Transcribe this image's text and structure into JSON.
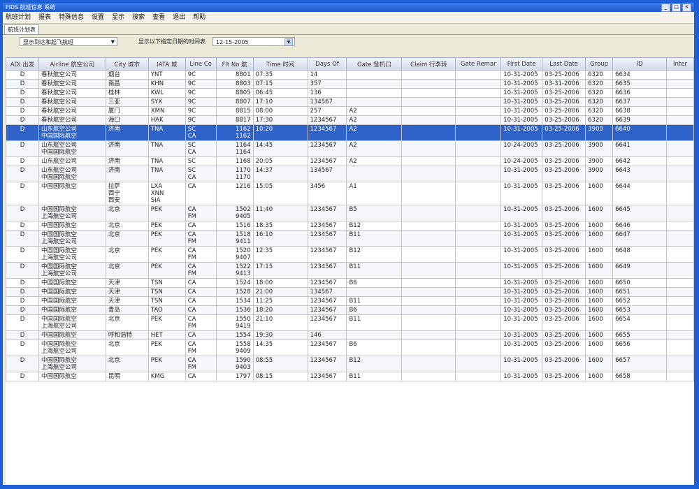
{
  "window": {
    "title": "FIDS 航班信息 系统"
  },
  "menu": [
    "航班计划",
    "报表",
    "特殊信息",
    "设置",
    "显示",
    "搜索",
    "查看",
    "退出",
    "帮助"
  ],
  "tab": {
    "label": "航班计划表"
  },
  "filter": {
    "select": "显示到达和起飞航班",
    "label": "显示以下指定日期的时间表",
    "date": "12-15-2005"
  },
  "columns": [
    "ADI 出发",
    "Airline 航空公司",
    "City 城市",
    "IATA 城",
    "Line Co",
    "Flt No 航",
    "Time 时间",
    "Days Of",
    "Gate 登机口",
    "Claim 行李转",
    "Gate Remar",
    "First Date",
    "Last Date",
    "Group",
    "ID",
    "Inter"
  ],
  "rows": [
    [
      "D",
      "春秋航空公司",
      "烟台",
      "YNT",
      "9C",
      "8801",
      "07:35",
      "14",
      "",
      "",
      "",
      "10-31-2005",
      "03-25-2006",
      "6320",
      "6634",
      ""
    ],
    [
      "D",
      "春秋航空公司",
      "南昌",
      "KHN",
      "9C",
      "8803",
      "07:15",
      "357",
      "",
      "",
      "",
      "10-31-2005",
      "03-31-2006",
      "6320",
      "6635",
      ""
    ],
    [
      "D",
      "春秋航空公司",
      "桂林",
      "KWL",
      "9C",
      "8805",
      "06:45",
      "136",
      "",
      "",
      "",
      "10-31-2005",
      "03-25-2006",
      "6320",
      "6636",
      ""
    ],
    [
      "D",
      "春秋航空公司",
      "三亚",
      "SYX",
      "9C",
      "8807",
      "17:10",
      "134567",
      "",
      "",
      "",
      "10-31-2005",
      "03-25-2006",
      "6320",
      "6637",
      ""
    ],
    [
      "D",
      "春秋航空公司",
      "厦门",
      "XMN",
      "9C",
      "8815",
      "08:00",
      "257",
      "A2",
      "",
      "",
      "10-31-2005",
      "03-25-2006",
      "6320",
      "6638",
      ""
    ],
    [
      "D",
      "春秋航空公司",
      "海口",
      "HAK",
      "9C",
      "8817",
      "17:30",
      "1234567",
      "A2",
      "",
      "",
      "10-31-2005",
      "03-25-2006",
      "6320",
      "6639",
      ""
    ],
    [
      "D",
      "山东航空公司\n中国国际航空",
      "济南",
      "TNA",
      "SC\nCA",
      "1162\n1162",
      "10:20",
      "1234567",
      "A2",
      "",
      "",
      "10-31-2005",
      "03-25-2006",
      "3900",
      "6640",
      ""
    ],
    [
      "D",
      "山东航空公司\n中国国际航空",
      "济南",
      "TNA",
      "SC\nCA",
      "1164\n1164",
      "14:45",
      "1234567",
      "A2",
      "",
      "",
      "10-24-2005",
      "03-25-2006",
      "3900",
      "6641",
      ""
    ],
    [
      "D",
      "山东航空公司",
      "济南",
      "TNA",
      "SC",
      "1168",
      "20:05",
      "1234567",
      "A2",
      "",
      "",
      "10-24-2005",
      "03-25-2006",
      "3900",
      "6642",
      ""
    ],
    [
      "D",
      "山东航空公司\n中国国际航空",
      "济南",
      "TNA",
      "SC\nCA",
      "1170\n1170",
      "14:37",
      "134567",
      "",
      "",
      "",
      "10-31-2005",
      "03-25-2006",
      "3900",
      "6643",
      ""
    ],
    [
      "D",
      "中国国际航空",
      "拉萨\n西宁\n西安",
      "LXA\nXNN\nSIA",
      "CA",
      "1216",
      "15:05",
      "3456",
      "A1",
      "",
      "",
      "10-31-2005",
      "03-25-2006",
      "1600",
      "6644",
      ""
    ],
    [
      "D",
      "中国国际航空\n上海航空公司",
      "北京",
      "PEK",
      "CA\nFM",
      "1502\n9405",
      "11:40",
      "1234567",
      "B5",
      "",
      "",
      "10-31-2005",
      "03-25-2006",
      "1600",
      "6645",
      ""
    ],
    [
      "D",
      "中国国际航空",
      "北京",
      "PEK",
      "CA",
      "1516",
      "18:35",
      "1234567",
      "B12",
      "",
      "",
      "10-31-2005",
      "03-25-2006",
      "1600",
      "6646",
      ""
    ],
    [
      "D",
      "中国国际航空\n上海航空公司",
      "北京",
      "PEK",
      "CA\nFM",
      "1518\n9411",
      "16:10",
      "1234567",
      "B11",
      "",
      "",
      "10-31-2005",
      "03-25-2006",
      "1600",
      "6647",
      ""
    ],
    [
      "D",
      "中国国际航空\n上海航空公司",
      "北京",
      "PEK",
      "CA\nFM",
      "1520\n9407",
      "12:35",
      "1234567",
      "B12",
      "",
      "",
      "10-31-2005",
      "03-25-2006",
      "1600",
      "6648",
      ""
    ],
    [
      "D",
      "中国国际航空\n上海航空公司",
      "北京",
      "PEK",
      "CA\nFM",
      "1522\n9413",
      "17:15",
      "1234567",
      "B11",
      "",
      "",
      "10-31-2005",
      "03-25-2006",
      "1600",
      "6649",
      ""
    ],
    [
      "D",
      "中国国际航空",
      "天津",
      "TSN",
      "CA",
      "1524",
      "18:00",
      "1234567",
      "B6",
      "",
      "",
      "10-31-2005",
      "03-25-2006",
      "1600",
      "6650",
      ""
    ],
    [
      "D",
      "中国国际航空",
      "天津",
      "TSN",
      "CA",
      "1528",
      "21:00",
      "134567",
      "",
      "",
      "",
      "10-31-2005",
      "03-25-2006",
      "1600",
      "6651",
      ""
    ],
    [
      "D",
      "中国国际航空",
      "天津",
      "TSN",
      "CA",
      "1534",
      "11:25",
      "1234567",
      "B11",
      "",
      "",
      "10-31-2005",
      "03-25-2006",
      "1600",
      "6652",
      ""
    ],
    [
      "D",
      "中国国际航空",
      "青岛",
      "TAO",
      "CA",
      "1536",
      "18:20",
      "1234567",
      "B6",
      "",
      "",
      "10-31-2005",
      "03-25-2006",
      "1600",
      "6653",
      ""
    ],
    [
      "D",
      "中国国际航空\n上海航空公司",
      "北京",
      "PEK",
      "CA\nFM",
      "1550\n9419",
      "21:10",
      "1234567",
      "B11",
      "",
      "",
      "10-31-2005",
      "03-25-2006",
      "1600",
      "6654",
      ""
    ],
    [
      "D",
      "中国国际航空",
      "呼和浩特",
      "HET",
      "CA",
      "1554",
      "19:30",
      "146",
      "",
      "",
      "",
      "10-31-2005",
      "03-25-2006",
      "1600",
      "6655",
      ""
    ],
    [
      "D",
      "中国国际航空\n上海航空公司",
      "北京",
      "PEK",
      "CA\nFM",
      "1558\n9409",
      "14:35",
      "1234567",
      "B6",
      "",
      "",
      "10-31-2005",
      "03-25-2006",
      "1600",
      "6656",
      ""
    ],
    [
      "D",
      "中国国际航空\n上海航空公司",
      "北京",
      "PEK",
      "CA\nFM",
      "1590\n9403",
      "08:55",
      "1234567",
      "B12",
      "",
      "",
      "10-31-2005",
      "03-25-2006",
      "1600",
      "6657",
      ""
    ],
    [
      "D",
      "中国国际航空",
      "昆明",
      "KMG",
      "CA",
      "1797",
      "08:15",
      "1234567",
      "B11",
      "",
      "",
      "10-31-2005",
      "03-25-2006",
      "1600",
      "6658",
      ""
    ]
  ],
  "selected_row": 6
}
